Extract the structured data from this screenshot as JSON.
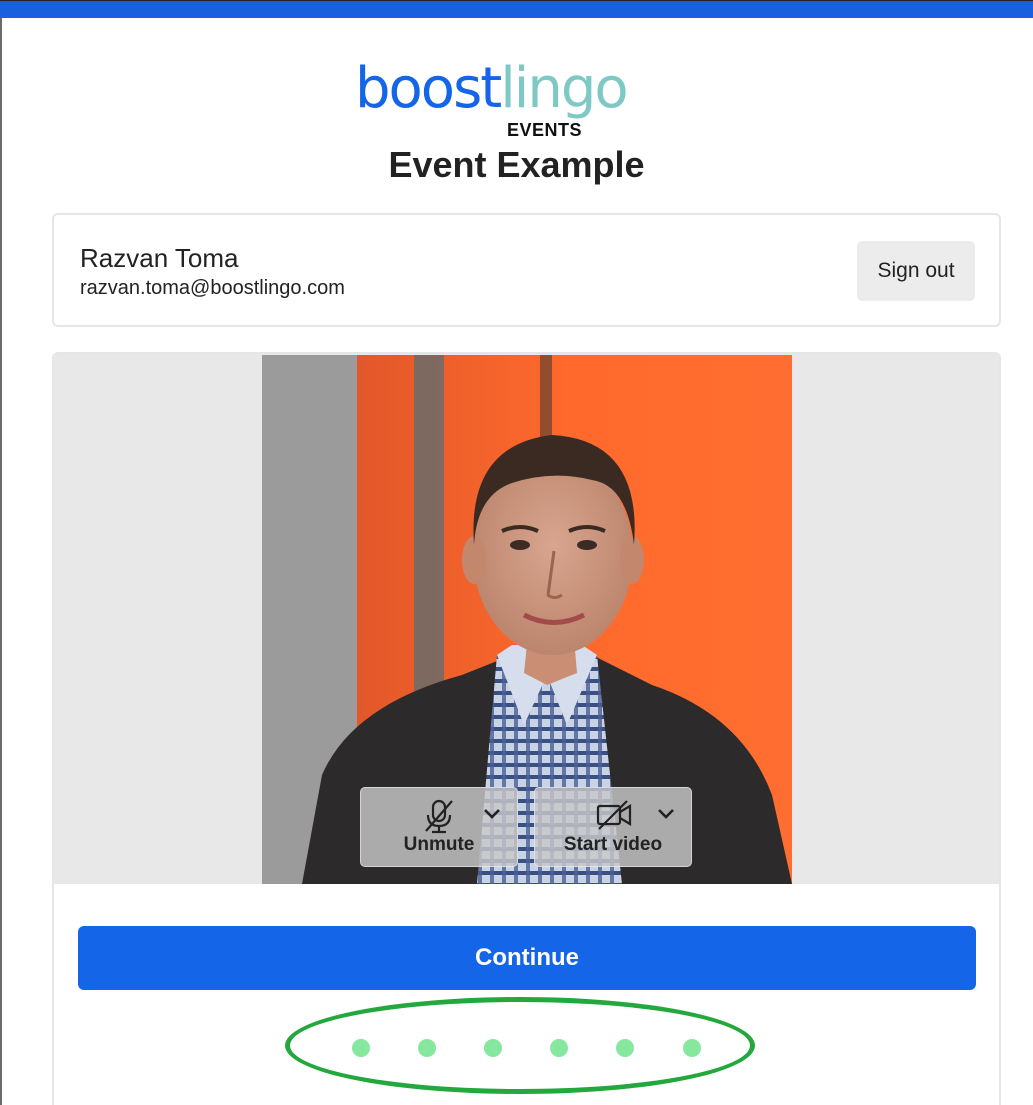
{
  "brand": {
    "logo_boost": "boost",
    "logo_lingo": "lingo",
    "logo_sub": "EVENTS",
    "primary_color": "#1565e8",
    "secondary_color": "#7ec9c5"
  },
  "event": {
    "title": "Event Example"
  },
  "user": {
    "name": "Razvan Toma",
    "email": "razvan.toma@boostlingo.com",
    "signout_label": "Sign out"
  },
  "media_controls": {
    "unmute_label": "Unmute",
    "unmute_icon": "microphone-off-icon",
    "start_video_label": "Start video",
    "start_video_icon": "camera-off-icon",
    "dropdown_icon": "chevron-down-icon"
  },
  "actions": {
    "continue_label": "Continue"
  },
  "loader": {
    "dot_count": 6,
    "dot_color": "#86e89e",
    "highlight_color": "#22a83d"
  }
}
